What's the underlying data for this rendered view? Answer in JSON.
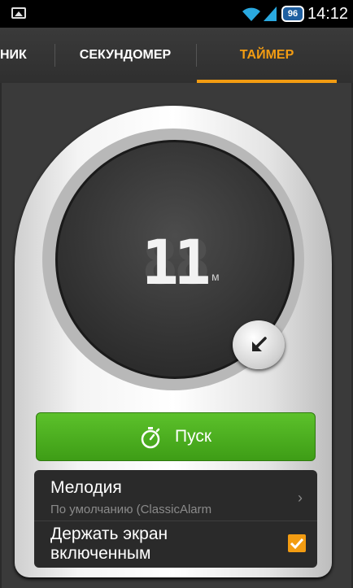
{
  "status_bar": {
    "time": "14:12",
    "battery_level": "96",
    "icons": [
      "gallery-icon",
      "wifi-icon",
      "signal-icon",
      "battery-icon"
    ]
  },
  "tabs": [
    {
      "label": "НИК"
    },
    {
      "label": "СЕКУНДОМЕР"
    },
    {
      "label": "ТАЙМЕР",
      "selected": true
    }
  ],
  "timer": {
    "display": "11",
    "unit": "м"
  },
  "start_button": {
    "label": "Пуск",
    "icon": "stopwatch-icon"
  },
  "settings": {
    "melody": {
      "title": "Мелодия",
      "subtitle": "По умолчанию (ClassicAlarm"
    },
    "keep_screen_on": {
      "label": "Держать экран включенным",
      "checked": true
    }
  },
  "colors": {
    "accent": "#f39c12",
    "start_button": "#4cae1f",
    "background": "#2b2b2b"
  }
}
